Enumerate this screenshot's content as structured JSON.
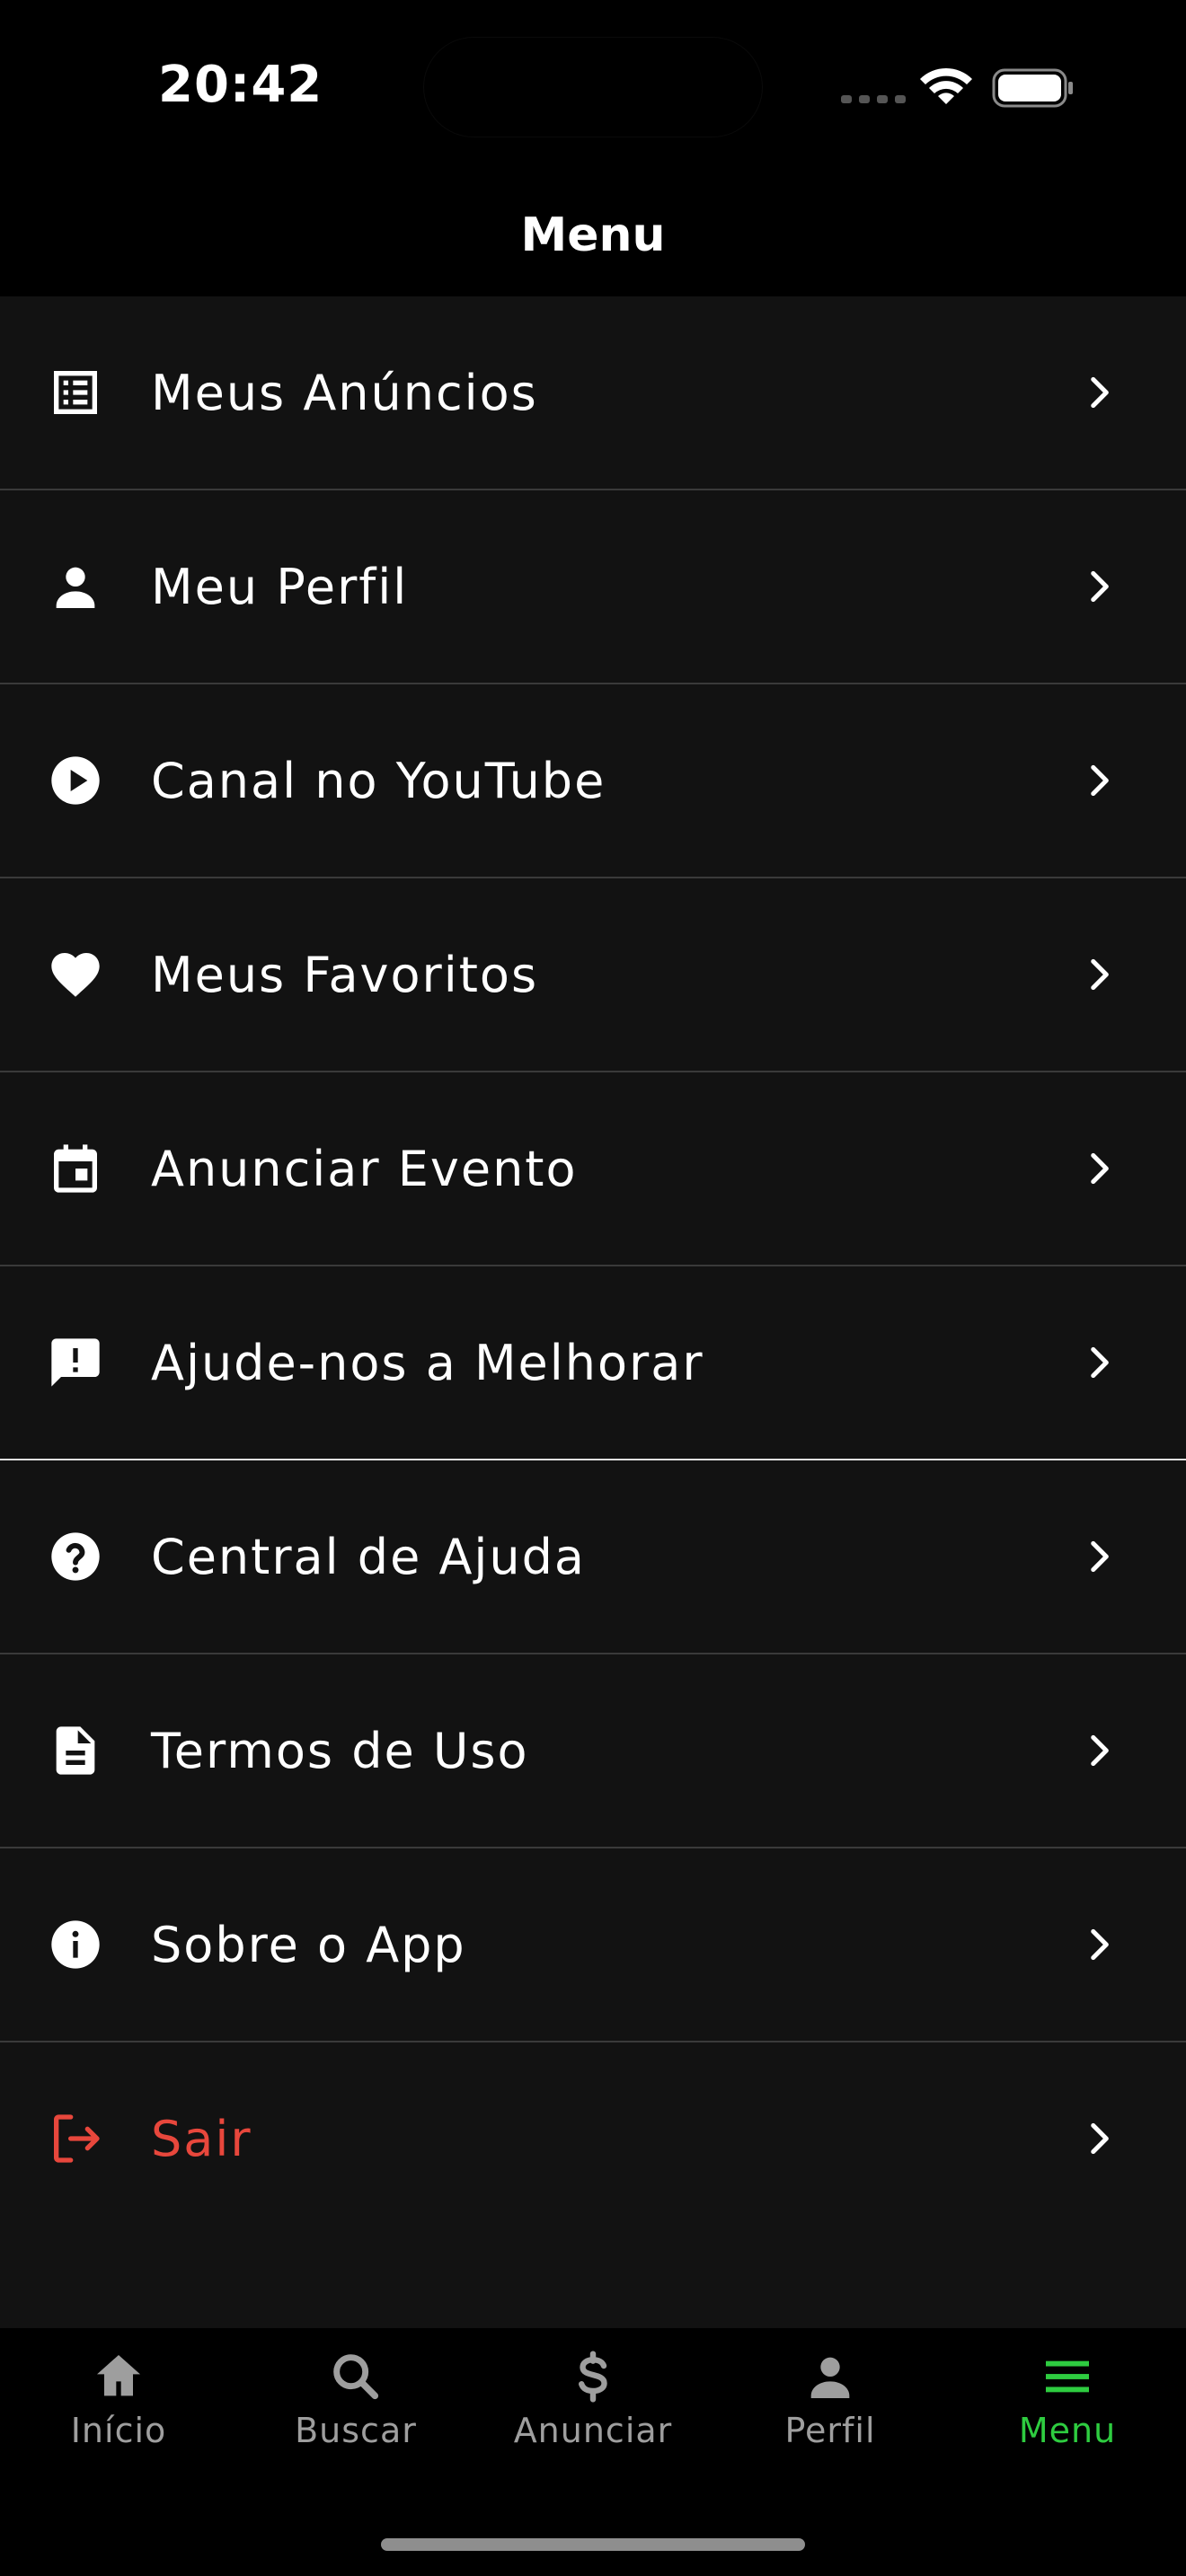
{
  "status_bar": {
    "time": "20:42"
  },
  "header": {
    "title": "Menu"
  },
  "menu": {
    "items": [
      {
        "label": "Meus Anúncios",
        "icon": "list-icon"
      },
      {
        "label": "Meu Perfil",
        "icon": "person-icon"
      },
      {
        "label": "Canal no YouTube",
        "icon": "play-circle-icon"
      },
      {
        "label": "Meus Favoritos",
        "icon": "heart-icon"
      },
      {
        "label": "Anunciar Evento",
        "icon": "calendar-icon"
      },
      {
        "label": "Ajude-nos a Melhorar",
        "icon": "feedback-icon"
      },
      {
        "label": "Central de Ajuda",
        "icon": "help-circle-icon"
      },
      {
        "label": "Termos de Uso",
        "icon": "document-icon"
      },
      {
        "label": "Sobre o App",
        "icon": "info-icon"
      },
      {
        "label": "Sair",
        "icon": "logout-icon"
      }
    ]
  },
  "tabbar": {
    "tabs": [
      {
        "label": "Início",
        "icon": "home-icon"
      },
      {
        "label": "Buscar",
        "icon": "search-icon"
      },
      {
        "label": "Anunciar",
        "icon": "dollar-icon"
      },
      {
        "label": "Perfil",
        "icon": "person-icon"
      },
      {
        "label": "Menu",
        "icon": "menu-icon"
      }
    ],
    "active_tab": "Menu"
  },
  "colors": {
    "background": "#121212",
    "text": "#ffffff",
    "danger": "#e8473c",
    "active_tab": "#2ecc40",
    "inactive_tab": "#9e9e9e"
  }
}
